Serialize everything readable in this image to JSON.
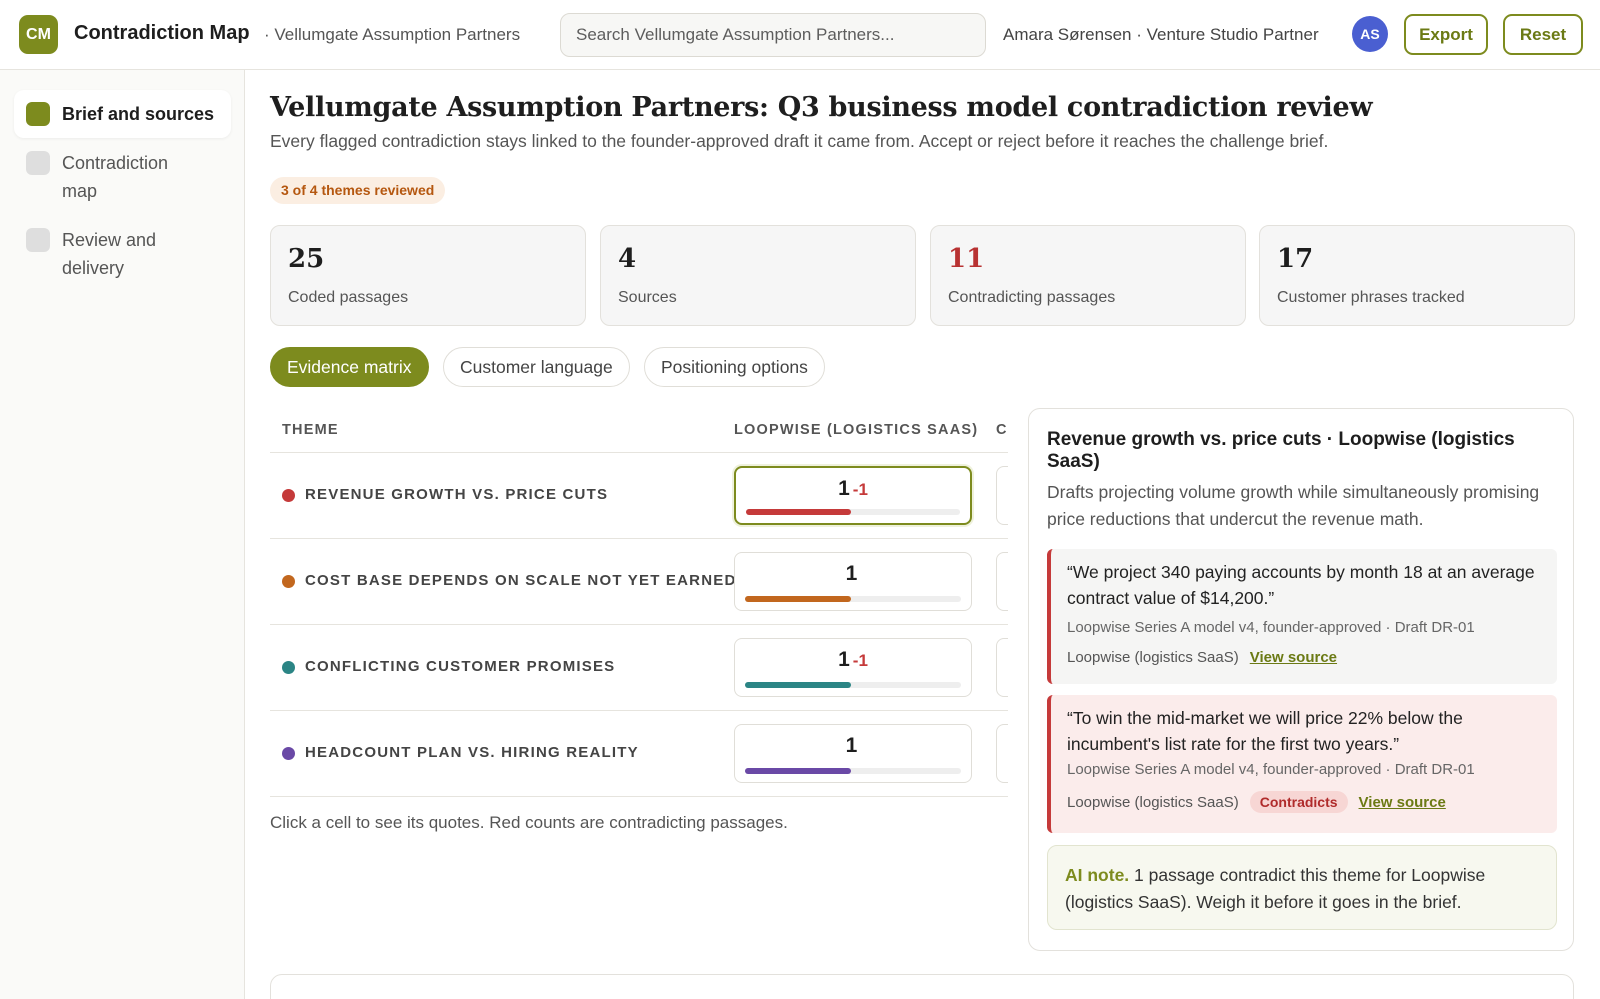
{
  "header": {
    "logo_text": "CM",
    "app_title": "Contradiction Map",
    "org_crumb": "· Vellumgate Assumption Partners",
    "search_placeholder": "Search Vellumgate Assumption Partners...",
    "user": "Amara Sørensen · Venture Studio Partner",
    "avatar": "AS",
    "export_label": "Export",
    "reset_label": "Reset"
  },
  "sidebar": {
    "items": [
      {
        "label": "Brief and sources",
        "active": true
      },
      {
        "label": "Contradiction map",
        "active": false
      },
      {
        "label": "Review and delivery",
        "active": false
      }
    ]
  },
  "main": {
    "title": "Vellumgate Assumption Partners: Q3 business model contradiction review",
    "subtitle": "Every flagged contradiction stays linked to the founder-approved draft it came from. Accept or reject before it reaches the challenge brief.",
    "progress": "3 of 4 themes reviewed",
    "stats": [
      {
        "value": "25",
        "label": "Coded passages"
      },
      {
        "value": "4",
        "label": "Sources"
      },
      {
        "value": "11",
        "label": "Contradicting passages"
      },
      {
        "value": "17",
        "label": "Customer phrases tracked"
      }
    ],
    "tabs": [
      {
        "label": "Evidence matrix",
        "active": true
      },
      {
        "label": "Customer language",
        "active": false
      },
      {
        "label": "Positioning options",
        "active": false
      }
    ]
  },
  "matrix": {
    "theme_header": "THEME",
    "column_header": "LOOPWISE (LOGISTICS SAAS)",
    "next_column_peek": "C",
    "rows": [
      {
        "theme": "REVENUE GROWTH VS. PRICE CUTS",
        "count": "1",
        "contra": "-1",
        "color": "#c53a3a",
        "fill": 0.49
      },
      {
        "theme": "COST BASE DEPENDS ON SCALE NOT YET EARNED",
        "count": "1",
        "contra": "",
        "color": "#c2671e",
        "fill": 0.49
      },
      {
        "theme": "CONFLICTING CUSTOMER PROMISES",
        "count": "1",
        "contra": "-1",
        "color": "#2b8585",
        "fill": 0.49
      },
      {
        "theme": "HEADCOUNT PLAN VS. HIRING REALITY",
        "count": "1",
        "contra": "",
        "color": "#6a49a6",
        "fill": 0.49
      }
    ],
    "note": "Click a cell to see its quotes. Red counts are contradicting passages."
  },
  "detail": {
    "title": "Revenue growth vs. price cuts · Loopwise (logistics SaaS)",
    "description": "Drafts projecting volume growth while simultaneously promising price reductions that undercut the revenue math.",
    "quotes": [
      {
        "text": "“We project 340 paying accounts by month 18 at an average contract value of $14,200.”",
        "source": "Loopwise Series A model v4, founder-approved · Draft DR-01",
        "company": "Loopwise (logistics SaaS)",
        "badge": "",
        "link": "View source"
      },
      {
        "text": "“To win the mid-market we will price 22% below the incumbent's list rate for the first two years.”",
        "source": "Loopwise Series A model v4, founder-approved · Draft DR-01",
        "company": "Loopwise (logistics SaaS)",
        "badge": "Contradicts",
        "link": "View source"
      }
    ],
    "ai_label": "AI note.",
    "ai_text": " 1 passage contradict this theme for Loopwise (logistics SaaS). Weigh it before it goes in the brief."
  }
}
